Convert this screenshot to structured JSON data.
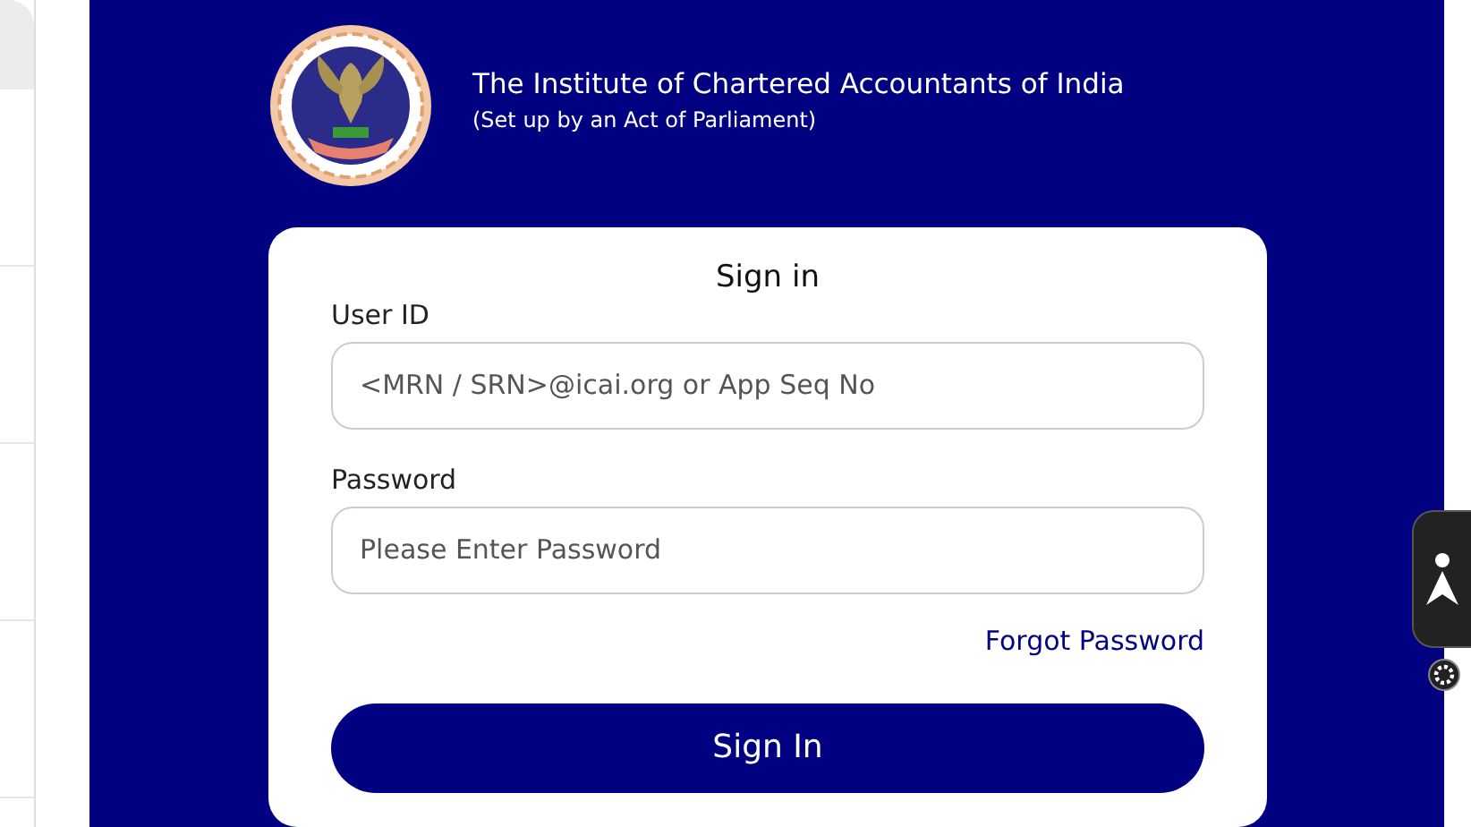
{
  "header": {
    "title": "The Institute of Chartered Accountants of India",
    "subtitle": "(Set up by an Act of Parliament)"
  },
  "signin": {
    "heading": "Sign in",
    "fields": [
      {
        "label": "User ID",
        "placeholder": "<MRN / SRN>@icai.org or App Seq No"
      },
      {
        "label": "Password",
        "placeholder": "Please Enter Password"
      }
    ],
    "forgot_link": "Forgot Password",
    "button": "Sign In"
  }
}
